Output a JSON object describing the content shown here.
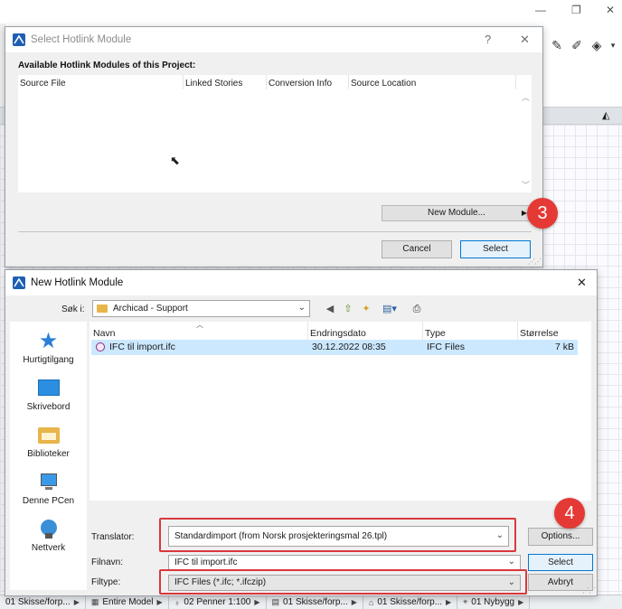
{
  "colors": {
    "badge": "#e53935",
    "highlight": "#d9383c",
    "selected_row": "#cce8ff",
    "accent": "#0078d7"
  },
  "statusbar": {
    "items": [
      "01 Skisse/forp...",
      "Entire Model",
      "02 Penner 1:100",
      "01 Skisse/forp...",
      "01 Skisse/forp...",
      "01 Nybygg"
    ]
  },
  "dialog1": {
    "title": "Select Hotlink Module",
    "help": "?",
    "close": "✕",
    "heading": "Available Hotlink Modules of this Project:",
    "columns": [
      "Source File",
      "Linked Stories",
      "Conversion Info",
      "Source Location"
    ],
    "new_module_label": "New Module...",
    "cancel_label": "Cancel",
    "select_label": "Select"
  },
  "badges": {
    "step3": "3",
    "step4": "4"
  },
  "dialog2": {
    "title": "New Hotlink Module",
    "close": "✕",
    "look_in_label": "Søk i:",
    "look_in_value": "Archicad - Support",
    "places": [
      "Hurtigtilgang",
      "Skrivebord",
      "Biblioteker",
      "Denne PCen",
      "Nettverk"
    ],
    "columns": [
      "Navn",
      "Endringsdato",
      "Type",
      "Størrelse"
    ],
    "files": [
      {
        "name": "IFC til import.ifc",
        "date": "30.12.2022 08:35",
        "type": "IFC Files",
        "size": "7 kB"
      }
    ],
    "translator_label": "Translator:",
    "translator_value": "Standardimport (from Norsk prosjekteringsmal 26.tpl)",
    "options_label": "Options...",
    "filename_label": "Filnavn:",
    "filename_value": "IFC til import.ifc",
    "filetype_label": "Filtype:",
    "filetype_value": "IFC Files (*.ifc; *.ifczip)",
    "select_label": "Select",
    "cancel_label": "Avbryt"
  }
}
